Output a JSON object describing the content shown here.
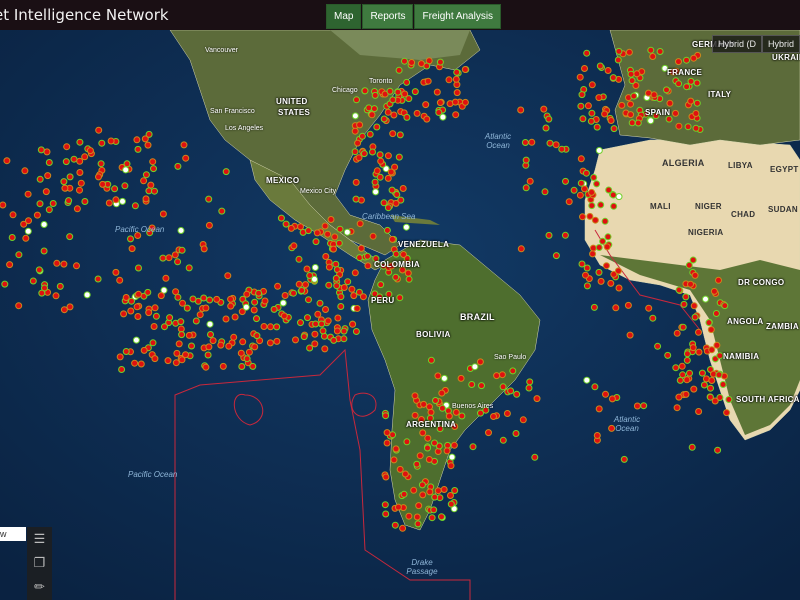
{
  "header": {
    "title": "et Intelligence Network",
    "tabs": [
      {
        "label": "Map"
      },
      {
        "label": "Reports"
      },
      {
        "label": "Freight Analysis"
      }
    ]
  },
  "layers": {
    "hybrid_dropdown": "Hybrid (D",
    "hybrid_button": "Hybrid"
  },
  "left_panel": {
    "label": "w",
    "tools": [
      {
        "icon": "layers-icon"
      },
      {
        "icon": "copy-icon"
      },
      {
        "icon": "ruler-icon"
      }
    ]
  },
  "countries": [
    {
      "name": "UNITED",
      "key": "us1"
    },
    {
      "name": "STATES",
      "key": "us2"
    },
    {
      "name": "MEXICO",
      "key": "mx"
    },
    {
      "name": "VENEZUELA",
      "key": "ve"
    },
    {
      "name": "COLOMBIA",
      "key": "co"
    },
    {
      "name": "PERU",
      "key": "pe"
    },
    {
      "name": "BRAZIL",
      "key": "br"
    },
    {
      "name": "BOLIVIA",
      "key": "bo"
    },
    {
      "name": "ARGENTINA",
      "key": "ar"
    },
    {
      "name": "ALGERIA",
      "key": "dz"
    },
    {
      "name": "LIBYA",
      "key": "ly"
    },
    {
      "name": "EGYPT",
      "key": "eg"
    },
    {
      "name": "MALI",
      "key": "ml"
    },
    {
      "name": "NIGER",
      "key": "ne"
    },
    {
      "name": "CHAD",
      "key": "td"
    },
    {
      "name": "SUDAN",
      "key": "sd"
    },
    {
      "name": "NIGERIA",
      "key": "ng"
    },
    {
      "name": "DR CONGO",
      "key": "cd"
    },
    {
      "name": "ANGOLA",
      "key": "ao"
    },
    {
      "name": "ZAMBIA",
      "key": "zm"
    },
    {
      "name": "NAMIBIA",
      "key": "na"
    },
    {
      "name": "SOUTH AFRICA",
      "key": "za"
    },
    {
      "name": "FRANCE",
      "key": "fr"
    },
    {
      "name": "SPAIN",
      "key": "es"
    },
    {
      "name": "GERMANY",
      "key": "de"
    },
    {
      "name": "UKRAINE",
      "key": "ua"
    },
    {
      "name": "ITALY",
      "key": "it"
    }
  ],
  "cities": [
    {
      "name": "Vancouver"
    },
    {
      "name": "San Francisco"
    },
    {
      "name": "Los Angeles"
    },
    {
      "name": "Chicago"
    },
    {
      "name": "Toronto"
    },
    {
      "name": "Mexico City"
    },
    {
      "name": "Sao Paulo"
    },
    {
      "name": "Buenos Aires"
    }
  ],
  "oceans": [
    {
      "name": "Pacific Ocean"
    },
    {
      "name": "Pacific Ocean"
    },
    {
      "name": "Atlantic Ocean"
    },
    {
      "name": "Atlantic Ocean"
    },
    {
      "name": "Caribbean Sea"
    },
    {
      "name": "Drake Passage"
    }
  ],
  "colors": {
    "vessel_red": "#e01010",
    "vessel_ring": "#6fd12a",
    "vessel_white": "#ffffff",
    "zone_line": "#c8283c",
    "ocean": "#0d2a4d",
    "land": "#5d6e34",
    "desert": "#efe2c4"
  }
}
